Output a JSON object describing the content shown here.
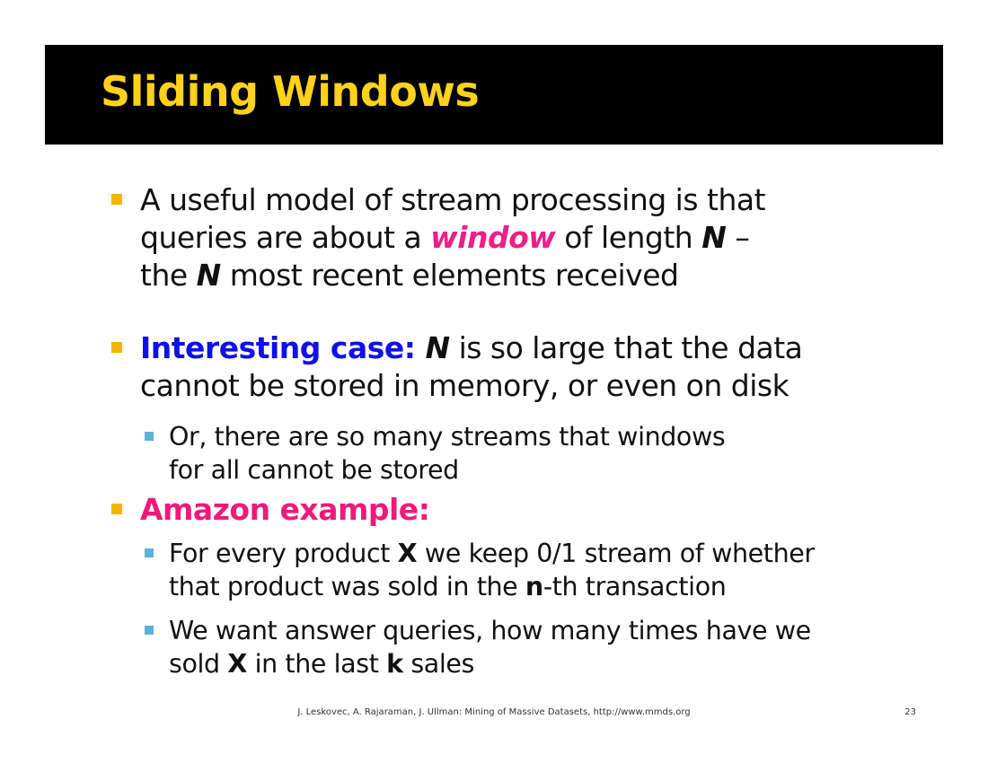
{
  "slide": {
    "title": "Sliding Windows",
    "bullets": {
      "b1": {
        "line1": "A useful model of stream processing is that",
        "line2_pre": "queries are about a ",
        "line2_em": "window",
        "line2_mid": " of length ",
        "line2_n": "N",
        "line2_post": " –",
        "line3_pre": "the ",
        "line3_n": "N",
        "line3_post": " most recent elements received"
      },
      "b2": {
        "label": "Interesting case: ",
        "n": "N",
        "line1_post": " is so large that the data",
        "line2": "cannot be stored in memory, or even on disk",
        "sub1_line1": "Or, there are so many streams that windows",
        "sub1_line2": "for all cannot be stored"
      },
      "b3": {
        "label": "Amazon example:",
        "sub1_pre": "For every product ",
        "sub1_x": "X",
        "sub1_post": " we keep 0/1 stream of whether",
        "sub1_line2_pre": "that product was sold in the ",
        "sub1_line2_n": "n",
        "sub1_line2_post": "-th transaction",
        "sub2_line1": "We want answer queries, how many times have we",
        "sub2_line2_pre": "sold ",
        "sub2_line2_x": "X",
        "sub2_line2_mid": " in the last ",
        "sub2_line2_k": "k",
        "sub2_line2_post": " sales"
      }
    },
    "footer": "J. Leskovec, A. Rajaraman, J. Ullman: Mining of Massive Datasets, http://www.mmds.org",
    "page_number": "23",
    "colors": {
      "title_bar": "#000000",
      "title_text": "#ffd21c",
      "bullet_marker": "#f5b400",
      "sub_marker": "#5bb3d6",
      "highlight_blue": "#1010e8",
      "highlight_pink": "#f0197a"
    }
  }
}
